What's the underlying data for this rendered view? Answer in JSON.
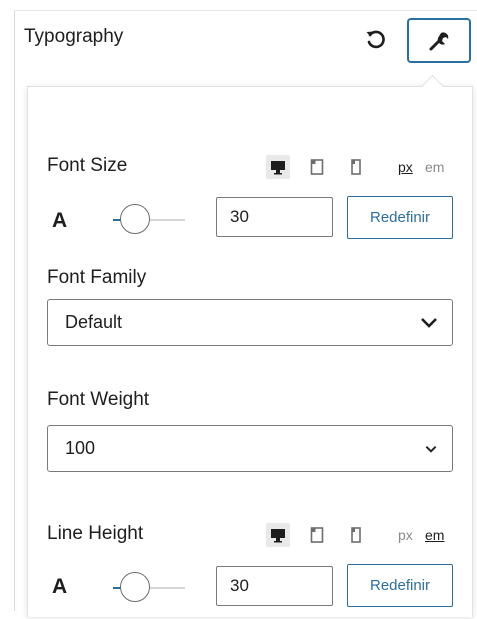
{
  "header": {
    "title": "Typography"
  },
  "font_size": {
    "label": "Font Size",
    "units": [
      "px",
      "em"
    ],
    "active_unit": "px",
    "value": "30",
    "reset_label": "Redefinir",
    "glyph": "A"
  },
  "font_family": {
    "label": "Font Family",
    "selected": "Default"
  },
  "font_weight": {
    "label": "Font Weight",
    "selected": "100"
  },
  "line_height": {
    "label": "Line Height",
    "units": [
      "px",
      "em"
    ],
    "active_unit": "em",
    "value": "30",
    "reset_label": "Redefinir",
    "glyph": "A"
  },
  "colors": {
    "accent": "#2b6fa0",
    "border": "#7a7a7a",
    "text": "#1e1e1e"
  },
  "icons": [
    "reset-icon",
    "wrench-icon",
    "desktop-icon",
    "tablet-icon",
    "mobile-icon",
    "chevron-down-icon"
  ]
}
